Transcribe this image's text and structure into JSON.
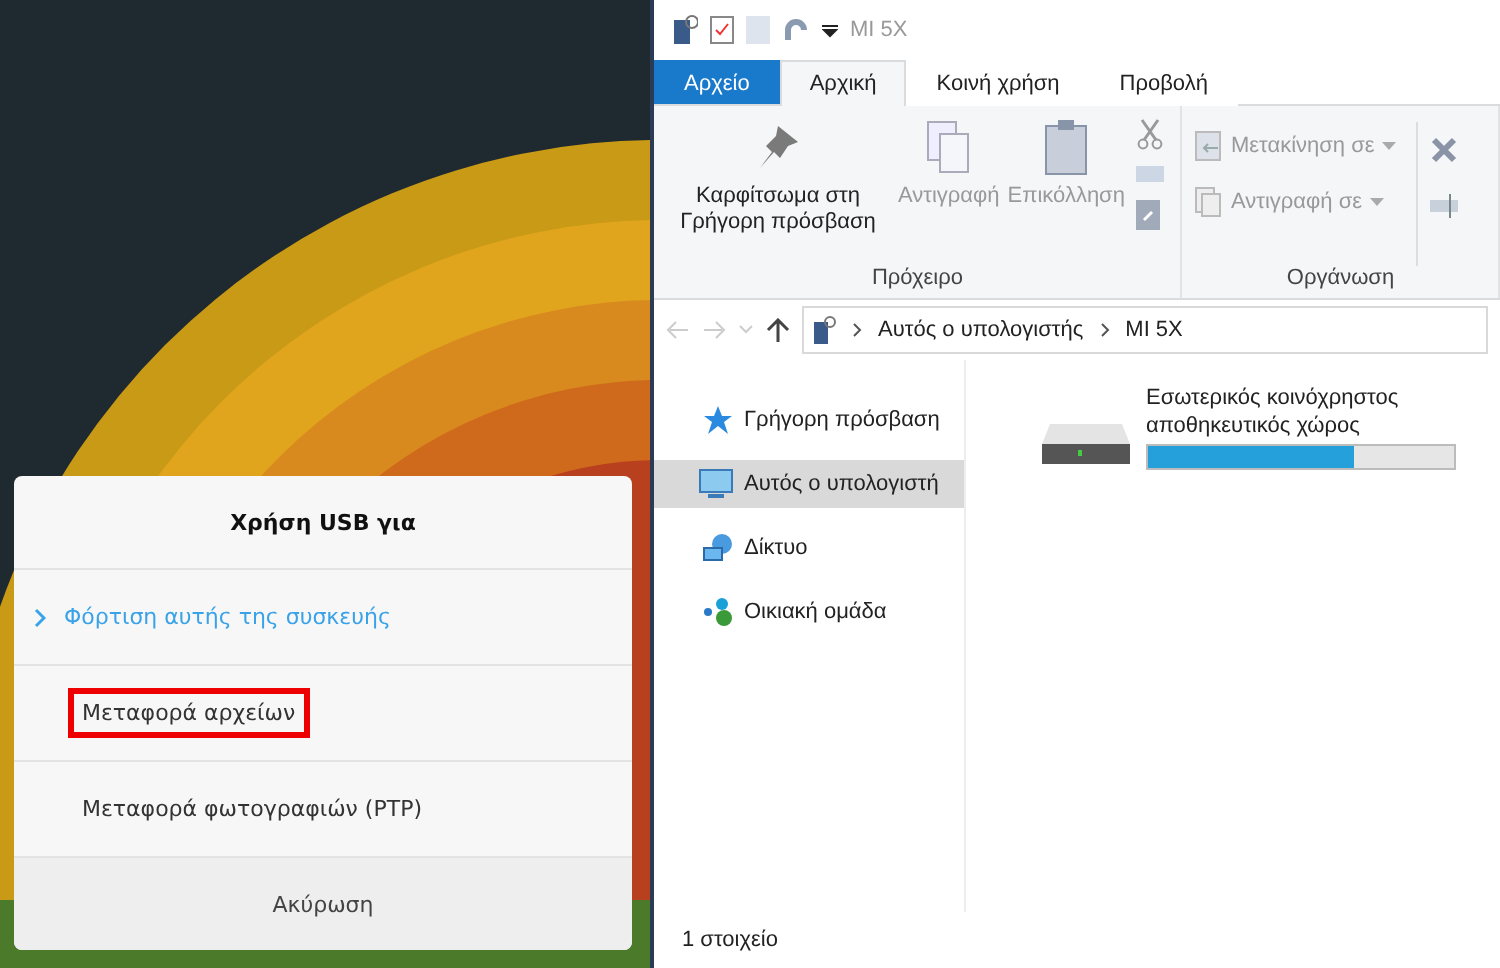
{
  "dialog": {
    "title": "Χρήση USB για",
    "options": [
      {
        "label": "Φόρτιση αυτής της συσκευής",
        "selected": true,
        "highlighted": false
      },
      {
        "label": "Μεταφορά αρχείων",
        "selected": false,
        "highlighted": true
      },
      {
        "label": "Μεταφορά φωτογραφιών (PTP)",
        "selected": false,
        "highlighted": false
      }
    ],
    "cancel": "Ακύρωση"
  },
  "window": {
    "title": "MI 5X"
  },
  "tabs": [
    {
      "label": "Αρχείο",
      "kind": "file",
      "selected": false
    },
    {
      "label": "Αρχική",
      "kind": "tab",
      "selected": true
    },
    {
      "label": "Κοινή χρήση",
      "kind": "tab",
      "selected": false
    },
    {
      "label": "Προβολή",
      "kind": "tab",
      "selected": false
    }
  ],
  "ribbon": {
    "groups": [
      {
        "label": "Πρόχειρο",
        "large": [
          {
            "label": "Καρφίτσωμα στη Γρήγορη πρόσβαση",
            "disabled": false
          },
          {
            "label": "Αντιγραφή",
            "disabled": true
          },
          {
            "label": "Επικόλληση",
            "disabled": true
          }
        ]
      },
      {
        "label": "Οργάνωση",
        "rows": [
          {
            "label": "Μετακίνηση σε"
          },
          {
            "label": "Αντιγραφή σε"
          }
        ]
      }
    ]
  },
  "address": {
    "crumbs": [
      "Αυτός ο υπολογιστής",
      "MI 5X"
    ]
  },
  "sidebar": {
    "items": [
      {
        "label": "Γρήγορη πρόσβαση",
        "selected": false
      },
      {
        "label": "Αυτός ο υπολογιστή",
        "selected": true
      },
      {
        "label": "Δίκτυο",
        "selected": false
      },
      {
        "label": "Οικιακή ομάδα",
        "selected": false
      }
    ]
  },
  "drives": [
    {
      "name": "Εσωτερικός κοινόχρηστος αποθηκευτικός χώρος",
      "level": 0.67
    }
  ],
  "status_bar": {
    "count": "1 στοιχείο"
  }
}
